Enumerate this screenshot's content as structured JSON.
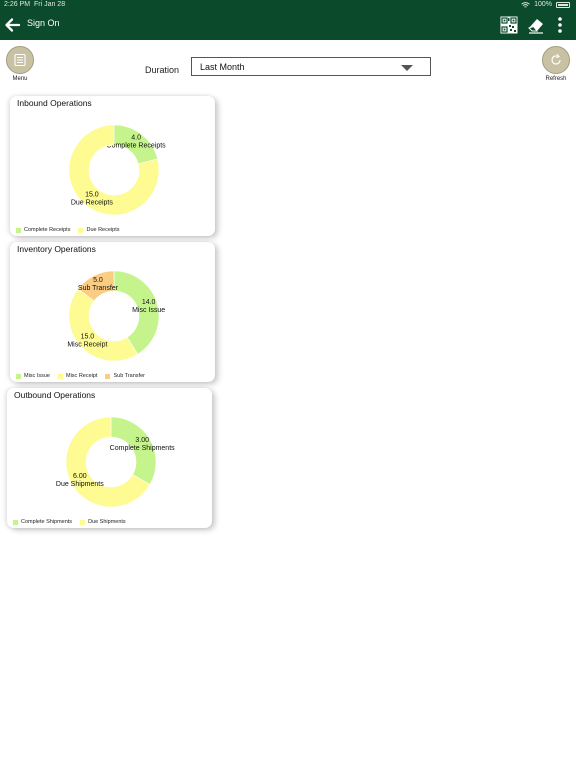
{
  "status_bar": {
    "time": "2:26 PM",
    "date": "Fri Jan 28",
    "battery": "100%"
  },
  "nav": {
    "title": "Sign On",
    "icons": [
      "back-arrow-icon",
      "qr-code-icon",
      "eraser-icon",
      "more-vertical-icon"
    ]
  },
  "colors": {
    "nav_bg": "#0b4a2b",
    "green": "#c4f48b",
    "yellow": "#fdfb92",
    "orange": "#fbcd83"
  },
  "menu": {
    "label": "Menu"
  },
  "refresh": {
    "label": "Refresh"
  },
  "duration": {
    "label": "Duration",
    "value": "Last Month"
  },
  "cards": [
    {
      "title": "Inbound Operations",
      "chart_data": {
        "type": "pie",
        "slices": [
          {
            "name": "Complete Receipts",
            "value": 4.0,
            "label": "4.0",
            "color": "#c4f48b"
          },
          {
            "name": "Due Receipts",
            "value": 15.0,
            "label": "15.0",
            "color": "#fdfb92"
          }
        ]
      }
    },
    {
      "title": "Inventory Operations",
      "chart_data": {
        "type": "pie",
        "slices": [
          {
            "name": "Misc Issue",
            "value": 14.0,
            "label": "14.0",
            "color": "#c4f48b"
          },
          {
            "name": "Misc Receipt",
            "value": 15.0,
            "label": "15.0",
            "color": "#fdfb92"
          },
          {
            "name": "Sub Transfer",
            "value": 5.0,
            "label": "5.0",
            "color": "#fbcd83"
          }
        ]
      }
    },
    {
      "title": "Outbound Operations",
      "chart_data": {
        "type": "pie",
        "slices": [
          {
            "name": "Complete Shipments",
            "value": 3.0,
            "label": "3.00",
            "color": "#c4f48b"
          },
          {
            "name": "Due Shipments",
            "value": 6.0,
            "label": "6.00",
            "color": "#fdfb92"
          }
        ]
      }
    }
  ]
}
